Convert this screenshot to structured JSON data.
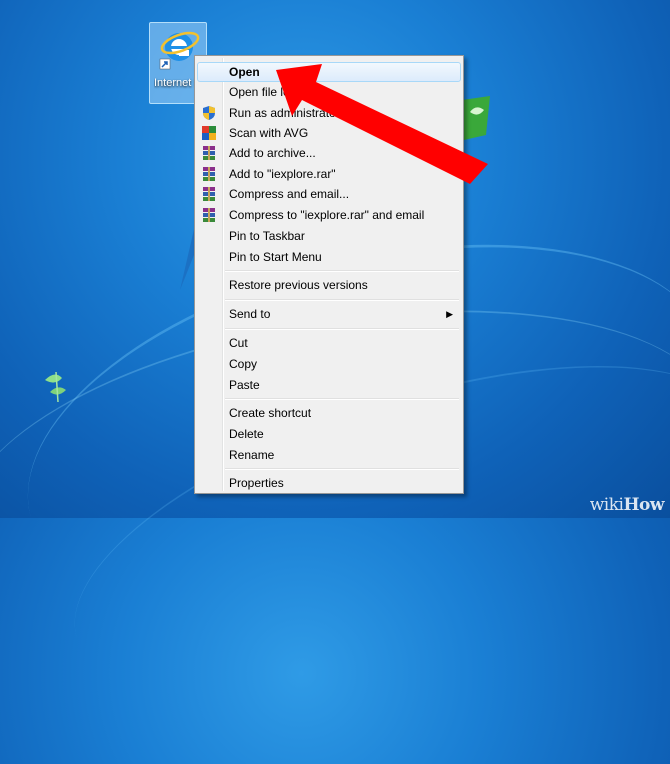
{
  "desktop": {
    "icon_label": "Internet Explorer"
  },
  "context_menu": {
    "items": [
      {
        "label": "Open",
        "icon": "",
        "highlight": true
      },
      {
        "label": "Open file location",
        "icon": ""
      },
      {
        "label": "Run as administrator",
        "icon": "uac-shield-icon"
      },
      {
        "label": "Scan with AVG",
        "icon": "avg-icon"
      },
      {
        "label": "Add to archive...",
        "icon": "winrar-icon"
      },
      {
        "label": "Add to \"iexplore.rar\"",
        "icon": "winrar-icon"
      },
      {
        "label": "Compress and email...",
        "icon": "winrar-icon"
      },
      {
        "label": "Compress to \"iexplore.rar\" and email",
        "icon": "winrar-icon"
      },
      {
        "label": "Pin to Taskbar",
        "icon": ""
      },
      {
        "label": "Pin to Start Menu",
        "icon": ""
      },
      {
        "label": "Restore previous versions",
        "icon": ""
      },
      {
        "label": "Send to",
        "icon": "",
        "submenu": true
      },
      {
        "label": "Cut",
        "icon": ""
      },
      {
        "label": "Copy",
        "icon": ""
      },
      {
        "label": "Paste",
        "icon": ""
      },
      {
        "label": "Create shortcut",
        "icon": ""
      },
      {
        "label": "Delete",
        "icon": ""
      },
      {
        "label": "Rename",
        "icon": ""
      },
      {
        "label": "Properties",
        "icon": ""
      }
    ]
  },
  "annotation": {
    "arrow_color": "#ff0000"
  },
  "watermark": {
    "text_a": "wiki",
    "text_b": "How"
  }
}
